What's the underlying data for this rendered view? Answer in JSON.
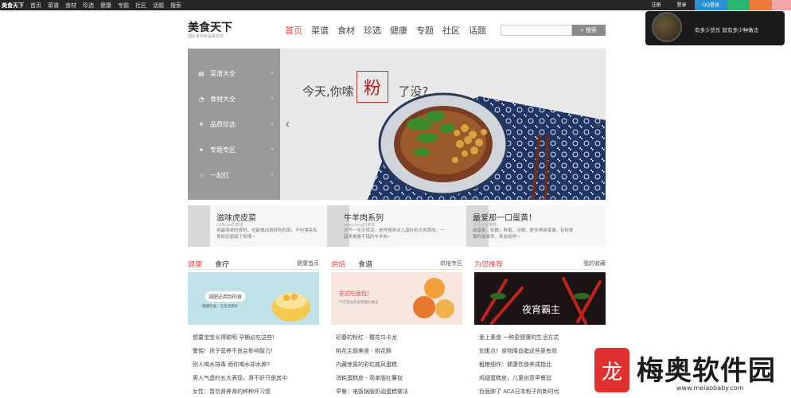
{
  "topbar": {
    "logo": "美食天下",
    "items": [
      "首页",
      "菜谱",
      "食材",
      "珍选",
      "健康",
      "专题",
      "社区",
      "话题",
      "搜索"
    ],
    "right": [
      "注册",
      "登录",
      "QQ登录",
      "",
      ""
    ],
    "colors": {
      "bg": "#262626",
      "qq": "#2a8fd6",
      "green": "#2bb673",
      "orange": "#f07a3c",
      "pink": "#f4a6a6"
    }
  },
  "header": {
    "logo_title": "美食天下",
    "logo_sub": "国民食材就是最爱你",
    "nav": [
      {
        "label": "首页",
        "active": true
      },
      {
        "label": "菜谱"
      },
      {
        "label": "食材"
      },
      {
        "label": "珍选"
      },
      {
        "label": "健康"
      },
      {
        "label": "专题"
      },
      {
        "label": "社区"
      },
      {
        "label": "话题"
      }
    ],
    "search": {
      "placeholder": "",
      "button": "搜索"
    },
    "accent": "#e0504d"
  },
  "popup": {
    "text": "有多少货乐 就有多少种做法"
  },
  "side_menu": [
    {
      "icon": "book-icon",
      "label": "菜谱大全"
    },
    {
      "icon": "apple-icon",
      "label": "食材大全"
    },
    {
      "icon": "wheat-icon",
      "label": "品质珍选"
    },
    {
      "icon": "star-icon",
      "label": "专题专区"
    },
    {
      "icon": "thumbs-up-icon",
      "label": "一起红"
    }
  ],
  "banner": {
    "text_left": "今天,你嗦",
    "stamp": "粉",
    "text_right": "了没?"
  },
  "features": [
    {
      "title": "滋味虎皮菜",
      "sub": "jiuAhua的菜谱",
      "desc": "用最简单的食材，也能做出很好吃的菜。不但漂亮有食欲还超级下饭哦~"
    },
    {
      "title": "牛羊肉系列",
      "sub": "zhanjiang的菜谱",
      "desc": "天气一天天转凉，是时候来点儿温补的大肉菜啦，一起来看看不错的牛羊肉~"
    },
    {
      "title": "最爱那一口蛋黄！",
      "sub": "天地大大推荐",
      "desc": "咸蛋黄，软糯，鲜香，沙糯，更多美味菜谱，有特爱黄的滋味来，来尝尝吧~"
    }
  ],
  "columns": [
    {
      "h1": "健康",
      "h2": "食疗",
      "more": "健康首页",
      "card": {
        "tag1": "减肥必用到的食",
        "tag2": "健康饮食，让生活更好"
      },
      "items": [
        "想要宝宝长得聪明 孕期必吃这些!",
        "警惕！孩子营养不良会影响智力!",
        "别人喝水排毒 而你喝水却水肿?",
        "男人气虚的五大表现，肾不好只是其中",
        "女性：暂勿肾养肾的种种坏习惯"
      ]
    },
    {
      "h1": "烘焙",
      "h2": "食谱",
      "more": "烘焙专区",
      "card": {
        "title": "花式吃面包！",
        "sub": "不可错过的美味面包做法"
      },
      "items": [
        "初春的粉红 - 樱花乌卡龙",
        "桃花主题美食 - 桃花酥",
        "内藏惊喜的彩虹戚风蛋糕",
        "消耗蛋糕皮 - 简单版红薯挞",
        "早餐：电饭锅版奶油蛋糕做法"
      ]
    },
    {
      "h1": "为您推荐",
      "h2": "",
      "more": "我的收藏",
      "card": {
        "badge": "夜宵霸主"
      },
      "items": [
        "爱上素食 一种更健康的生活方式",
        "划重点！食物降血脂这些更有效",
        "粗粮细作：健康饮食养成指北",
        "鸡翅蛋糕皮，儿童创意早餐怼",
        "负面肿了 ACA日本粉子的新时代"
      ]
    }
  ],
  "watermark": {
    "logo_char": "龙",
    "title": "梅奥软件园",
    "url": "www.meiaobaby.com"
  }
}
